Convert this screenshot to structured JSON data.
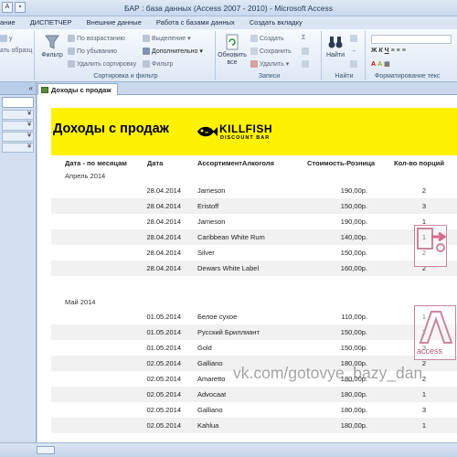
{
  "window": {
    "title": "БАР : база данных (Access 2007 - 2010)  -  Microsoft Access"
  },
  "ribbon_tabs": [
    "ание",
    "ДИСПЕТЧЕР",
    "Внешние данные",
    "Работа с базами данных",
    "Создать вкладку"
  ],
  "ribbon": {
    "clipboard_cut_label": "у",
    "clipboard_format_label": "ать образц",
    "filter_label": "Фильтр",
    "sort_asc": "По возрастанию",
    "sort_desc": "По убыванию",
    "remove_sort": "Удалить сортировку",
    "selection": "Выделение",
    "advanced": "Дополнительно",
    "toggle_filter": "Фильтр",
    "group_sort_filter": "Сортировка и фильтр",
    "refresh_all": "Обновить\nвсе",
    "new": "Создать",
    "save": "Сохранить",
    "delete": "Удалить",
    "group_records": "Записи",
    "find": "Найти",
    "group_find": "Найти",
    "group_formatting": "Форматирование текс"
  },
  "document_tab": "Доходы с продаж",
  "report": {
    "title": "Доходы с продаж",
    "logo_name": "KILLFISH",
    "logo_sub": "DISCOUNT BAR",
    "columns": {
      "month": "Дата - по месяцам",
      "date": "Дата",
      "assortment": "АссортиментАлкоголя",
      "price": "Стоимость-Розница",
      "qty": "Кол-во порций"
    },
    "groups": [
      {
        "label": "Апрель 2014",
        "rows": [
          {
            "date": "28.04.2014",
            "name": "Jameson",
            "price": "190,00р.",
            "qty": "2"
          },
          {
            "date": "28.04.2014",
            "name": "Eristoff",
            "price": "150,00р.",
            "qty": "3"
          },
          {
            "date": "28.04.2014",
            "name": "Jameson",
            "price": "190,00р.",
            "qty": "1"
          },
          {
            "date": "28.04.2014",
            "name": "Caribbean White Rum",
            "price": "140,00р.",
            "qty": "1"
          },
          {
            "date": "28.04.2014",
            "name": "Silver",
            "price": "150,00р.",
            "qty": "2"
          },
          {
            "date": "28.04.2014",
            "name": "Dewars White Label",
            "price": "160,00р.",
            "qty": "2"
          }
        ]
      },
      {
        "label": "Май 2014",
        "rows": [
          {
            "date": "01.05.2014",
            "name": "Белое сухое",
            "price": "110,00р.",
            "qty": "1"
          },
          {
            "date": "01.05.2014",
            "name": "Русский Бриллиант",
            "price": "150,00р.",
            "qty": "2"
          },
          {
            "date": "01.05.2014",
            "name": "Gold",
            "price": "150,00р.",
            "qty": "3"
          },
          {
            "date": "02.05.2014",
            "name": "Galliano",
            "price": "180,00р.",
            "qty": "2"
          },
          {
            "date": "02.05.2014",
            "name": "Amaretto",
            "price": "180,00р.",
            "qty": "2"
          },
          {
            "date": "02.05.2014",
            "name": "Advocaat",
            "price": "180,00р.",
            "qty": "1"
          },
          {
            "date": "02.05.2014",
            "name": "Galliano",
            "price": "180,00р.",
            "qty": "3"
          },
          {
            "date": "02.05.2014",
            "name": "Kahlua",
            "price": "180,00р.",
            "qty": "1"
          }
        ]
      }
    ]
  },
  "watermark": {
    "url": "vk.com/gotovye_bazy_dan",
    "access_label": "access"
  },
  "colors": {
    "banner": "#fff200",
    "ribbon_bg": "#dde8f5",
    "alt_row": "#f1f1f1"
  }
}
